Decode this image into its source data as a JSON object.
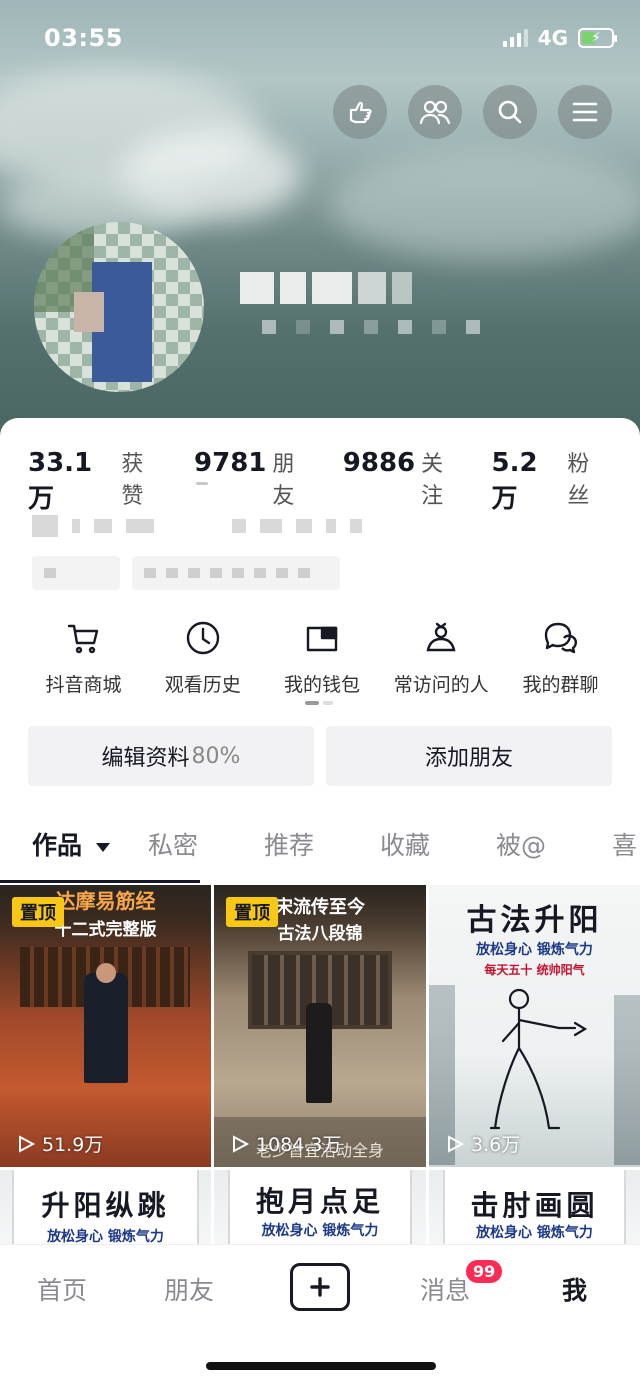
{
  "status_bar": {
    "time": "03:55",
    "network": "4G"
  },
  "header": {
    "buttons": [
      {
        "name": "poke-button",
        "icon": "poke-hand-icon"
      },
      {
        "name": "friends-button",
        "icon": "people-icon"
      },
      {
        "name": "search-button",
        "icon": "search-icon"
      },
      {
        "name": "menu-button",
        "icon": "hamburger-menu-icon"
      }
    ]
  },
  "stats": {
    "likes_value": "33.1万",
    "likes_label": "获赞",
    "friends_value": "9781",
    "friends_label": "朋友",
    "following_value": "9886",
    "following_label": "关注",
    "fans_value": "5.2万",
    "fans_label": "粉丝"
  },
  "shortcuts": [
    {
      "label": "抖音商城",
      "icon": "cart-icon"
    },
    {
      "label": "观看历史",
      "icon": "clock-icon"
    },
    {
      "label": "我的钱包",
      "icon": "wallet-icon"
    },
    {
      "label": "常访问的人",
      "icon": "person-visit-icon"
    },
    {
      "label": "我的群聊",
      "icon": "group-chat-icon"
    }
  ],
  "actions": {
    "edit_label": "编辑资料",
    "edit_percent": "80%",
    "add_friend_label": "添加朋友"
  },
  "tabs": [
    "作品",
    "私密",
    "推荐",
    "收藏",
    "被@",
    "喜"
  ],
  "videos": [
    {
      "pinned": true,
      "pin_label": "置顶",
      "title_line1": "达摩易筋经",
      "title_line2": "十二式完整版",
      "views": "51.9万"
    },
    {
      "pinned": true,
      "pin_label": "置顶",
      "title_line1": "宋流传至今",
      "title_line2": "古法八段锦",
      "caption": "老少皆宜活动全身",
      "views": "1084.3万"
    },
    {
      "pinned": false,
      "title": "古法升阳",
      "subtitle": "放松身心 锻炼气力",
      "tagline": "每天五十 统帅阳气",
      "views": "3.6万"
    },
    {
      "title": "升阳纵跳",
      "subtitle": "放松身心 锻炼气力"
    },
    {
      "title": "抱月点足",
      "subtitle": "放松身心 锻炼气力"
    },
    {
      "title": "击肘画圆",
      "subtitle": "放松身心 锻炼气力"
    }
  ],
  "bottom_nav": {
    "home": "首页",
    "friends": "朋友",
    "messages": "消息",
    "me": "我",
    "message_badge": "99"
  },
  "colors": {
    "accent": "#fe2c55",
    "pin": "#f9c814",
    "text": "#161823"
  }
}
